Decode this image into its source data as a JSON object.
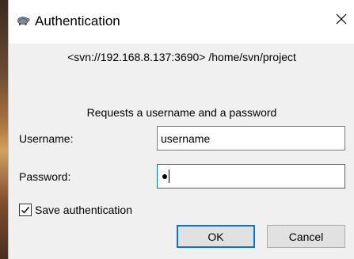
{
  "window": {
    "title": "Authentication",
    "app_icon": "tortoise-icon",
    "close_icon": "close-icon"
  },
  "content": {
    "url": "<svn://192.168.8.137:3690> /home/svn/project",
    "prompt": "Requests a username and a password"
  },
  "form": {
    "username_label": "Username:",
    "username_value": "username",
    "password_label": "Password:",
    "password_masked_count": 1,
    "save_auth_label": "Save authentication",
    "save_auth_checked": true
  },
  "buttons": {
    "ok_label": "OK",
    "cancel_label": "Cancel"
  },
  "colors": {
    "focus_accent": "#0078d7",
    "dialog_bg": "#f0f0f0"
  }
}
